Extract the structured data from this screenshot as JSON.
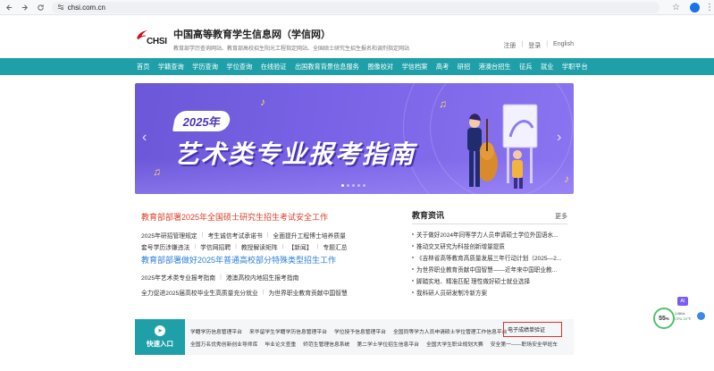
{
  "browser": {
    "url": "chsi.com.cn"
  },
  "site": {
    "logo_mark": "CHSI",
    "title": "中国高等教育学生信息网（学信网）",
    "subtitle": "教育部学历查询网站、教育部高校招生阳光工程指定网站、全国硕士研究生招生报名和调剂指定网站",
    "header_links": [
      "注册",
      "登录",
      "English"
    ]
  },
  "nav": [
    "首页",
    "学籍查询",
    "学历查询",
    "学位查询",
    "在线验证",
    "出国教育背景信息服务",
    "图像校对",
    "学信档案",
    "高考",
    "研招",
    "港澳台招生",
    "征兵",
    "就业",
    "学职平台"
  ],
  "banner": {
    "year": "2025年",
    "title": "艺术类专业报考指南"
  },
  "news_left": {
    "headline1": "教育部部署2025年全国硕士研究生招生考试安全工作",
    "row1": [
      "2025年研招管理规定",
      "考生诚信考试承诺书",
      "全面提升工程博士培养质量"
    ],
    "row2": [
      "套号学历涉嫌违法",
      "学信网招聘",
      "教授解读矩阵",
      "【新闻】",
      "专题汇总"
    ],
    "headline2": "教育部部署做好2025年普通高校部分特殊类型招生工作",
    "row3": [
      "2025年艺术类专业报考指南",
      "港澳高校内地招生报考指南"
    ],
    "row4": [
      "全力促进2025届高校毕业生高质量充分就业",
      "为世界职业教育贡献中国智慧"
    ]
  },
  "news_right": {
    "title": "教育资讯",
    "more": "更多",
    "items": [
      "关于做好2024年同等学力人员申请硕士学位外国语水...",
      "推动交叉研究为科技创新增量提质",
      "《吉林省高等教育高质量发展三年行动计划（2025—2...",
      "为世界职业教育贡献中国智慧——近年来中国职业教...",
      "脚踏实地、精准匹配 理性做好硕士就业选择",
      "我科研人员研发制冷新方案"
    ]
  },
  "quick": {
    "entry_label": "快速入口",
    "row1": [
      "学籍学历信息管理平台",
      "来华留学生学籍学历信息管理平台",
      "学位授予信息管理平台",
      "全国同等学力人员申请硕士学位管理工作信息平台"
    ],
    "highlight": "电子成绩单验证",
    "row2": [
      "全国万名优秀创新创业导师库",
      "毕业论文查重",
      "师范生管理信息系统",
      "第二学士学位招生信息平台",
      "全国大学生职业规划大赛",
      "安全第一——职场安全早班车"
    ]
  },
  "widgets": {
    "ai": "AI",
    "meter_value": "55",
    "meter_unit": "%",
    "speed": "1.6K/s",
    "cpu": "CPU 22℃"
  }
}
